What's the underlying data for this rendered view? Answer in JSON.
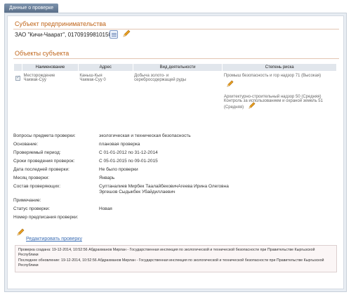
{
  "tab": {
    "label": "Данные о проверке"
  },
  "subject": {
    "title": "Субъект предпринимательства",
    "line": "ЗАО \"Кичи-Чаарат\", 01709199810150"
  },
  "objects": {
    "title": "Объекты субъекта",
    "headers": [
      "Наименование",
      "Адрес",
      "Вид деятельности",
      "Степень риска"
    ],
    "row": {
      "name_1": "Месторождение",
      "name_2": "Чакмак-Суу",
      "address_1": "Каныш-Кыя",
      "address_2": "Чакмак-Суу 0",
      "activity_1": "Добыча золото- и",
      "activity_2": "серебросодержащей руды",
      "risk_1": "Промыш безопасность и гор надзор 71 (Высокая)",
      "risk_2a": "Архитектурно-строительный надзор 50 (Средняя)",
      "risk_2b": "Контроль за использованием и охраной земель 51",
      "risk_2c": "(Средняя)"
    }
  },
  "details": {
    "subject_label": "Вопросы предмета проверки:",
    "subject_value": "экологическая и техническая безопасность",
    "basis_label": "Основание:",
    "basis_value": "плановая проверка",
    "period_label": "Проверяемый период:",
    "period_value": "С 01-01-2012 по 31-12-2014",
    "terms_label": "Сроки проведения проверок:",
    "terms_value": "С 05-01-2015 по 09-01-2015",
    "last_label": "Дата последней проверки:",
    "last_value": "Не было проверки",
    "month_label": "Месяц проверки:",
    "month_value": "Январь",
    "team_label": "Состав проверяющих:",
    "team_value_1": "Султаналиев Мирбек ТаалайбековичАгеева Ирина Олеговна",
    "team_value_2": "Эргешов Сыдыкбек Убайдиллаевич",
    "note_label": "Примечание:",
    "note_value": "",
    "status_label": "Статус проверки:",
    "status_value": "Новая",
    "prescription_label": "Номер предписания проверки:",
    "prescription_value": ""
  },
  "edit_link": "Редактировать проверку",
  "info": {
    "created": "Проверка создана: 19-12-2014, 10:52:56 Абдрахманов Мирлан - Государственная инспекция по экологической и технической безопасности при Правительстве Кыргызской Республики",
    "updated": "Последнее обновление: 19-12-2014, 10:52:56 Абдрахманов Мирлан - Государственная инспекция по экологической и технической безопасности при Правительстве Кыргызской Республики"
  },
  "colors": {
    "accent": "#c0651a",
    "link": "#3d6fb5",
    "tab": "#5a6f89"
  },
  "icons": {
    "edit": "pencil-icon",
    "list": "list-icon"
  }
}
